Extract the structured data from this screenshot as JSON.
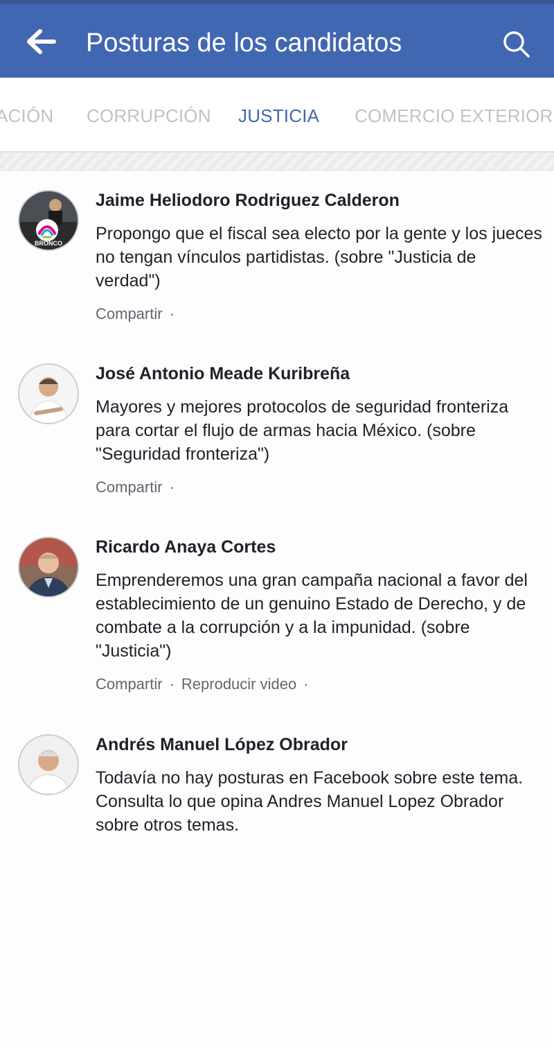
{
  "header": {
    "title": "Posturas de los candidatos",
    "back_icon": "arrow-left-icon",
    "search_icon": "search-icon",
    "bg_color": "#4267b2"
  },
  "tabs": [
    {
      "label": "ACIÓN",
      "active": false
    },
    {
      "label": "CORRUPCIÓN",
      "active": false
    },
    {
      "label": "JUSTICIA",
      "active": true
    },
    {
      "label": "COMERCIO EXTERIOR",
      "active": false
    }
  ],
  "candidates": [
    {
      "name": "Jaime Heliodoro Rodriguez Calderon",
      "stance": "Propongo que el fiscal sea electo por la gente y los jueces no tengan vínculos partidistas. (sobre \"Justicia de verdad\")",
      "avatar_text": "BRONCO",
      "share": "Compartir",
      "sep": "·",
      "video": ""
    },
    {
      "name": "José Antonio Meade Kuribreña",
      "stance": "Mayores y mejores protocolos de seguridad fronteriza para cortar el flujo de armas hacia México. (sobre \"Seguridad fronteriza\")",
      "share": "Compartir",
      "sep": "·",
      "video": ""
    },
    {
      "name": "Ricardo Anaya Cortes",
      "stance": "Emprenderemos una gran campaña nacional a favor del establecimiento de un genuino Estado de Derecho, y de combate a la corrupción y a la impunidad. (sobre \"Justicia\")",
      "share": "Compartir",
      "sep": "·",
      "video": "Reproducir video"
    },
    {
      "name": "Andrés Manuel López Obrador",
      "stance": "Todavía no hay posturas en Facebook sobre este tema. Consulta lo que opina Andres Manuel Lopez Obrador sobre otros temas."
    }
  ]
}
